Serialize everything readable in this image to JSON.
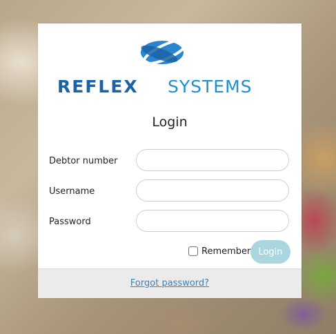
{
  "brand": {
    "name_part1": "REFLEX",
    "name_part2": "SYSTEMS",
    "color_dark": "#1b63a6",
    "color_light": "#1e8fd1"
  },
  "form": {
    "title": "Login",
    "fields": [
      {
        "label": "Debtor number",
        "value": "",
        "placeholder": ""
      },
      {
        "label": "Username",
        "value": "",
        "placeholder": ""
      },
      {
        "label": "Password",
        "value": "",
        "placeholder": ""
      }
    ],
    "remember_label": "Remember",
    "remember_checked": false,
    "login_label": "Login",
    "login_color": "#a9d6df"
  },
  "footer": {
    "forgot_label": "Forgot password?"
  }
}
